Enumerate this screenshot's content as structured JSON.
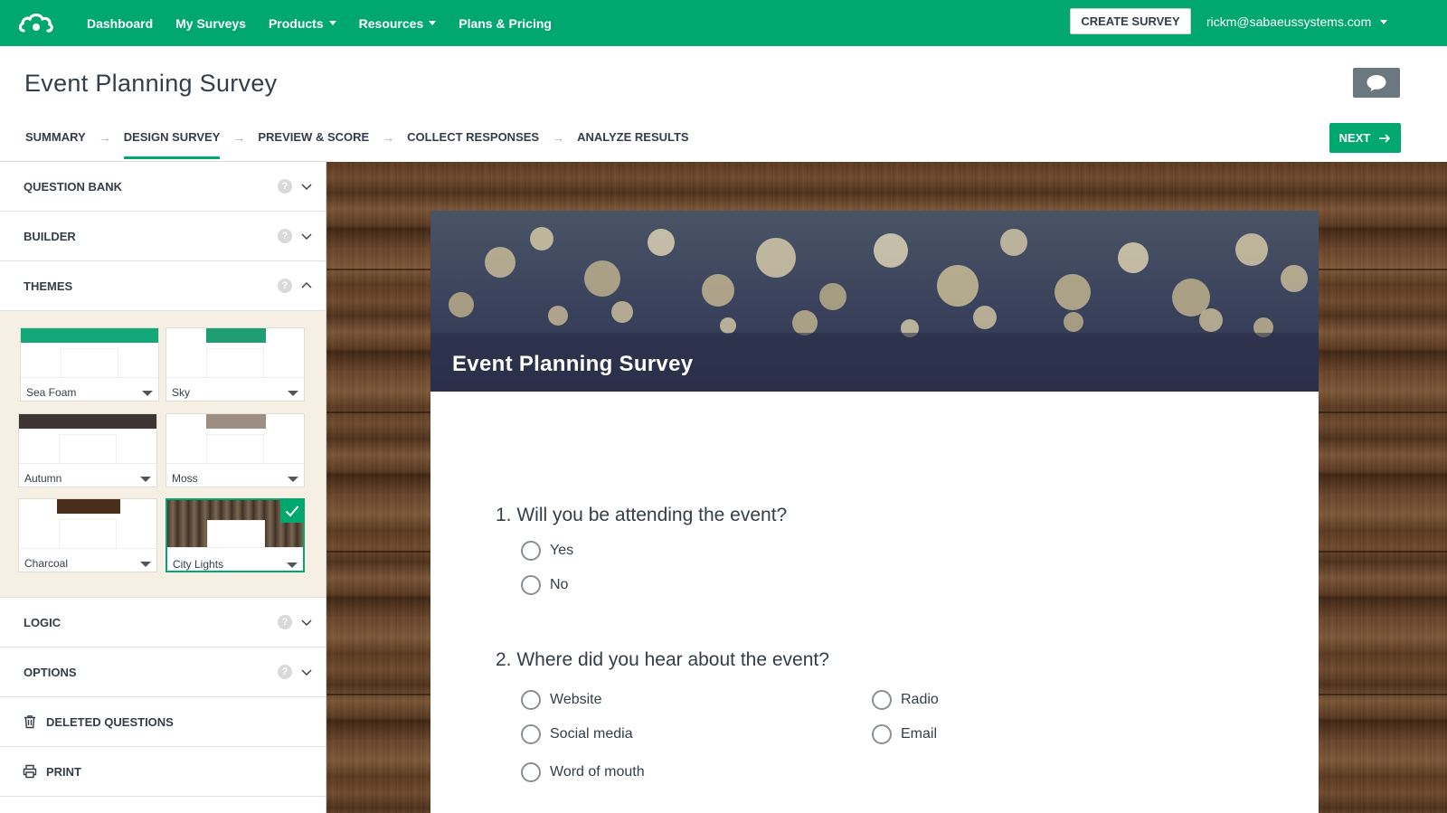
{
  "nav": {
    "items": [
      {
        "label": "Dashboard",
        "dropdown": false
      },
      {
        "label": "My Surveys",
        "dropdown": false
      },
      {
        "label": "Products",
        "dropdown": true
      },
      {
        "label": "Resources",
        "dropdown": true
      },
      {
        "label": "Plans & Pricing",
        "dropdown": false
      }
    ],
    "create_label": "CREATE SURVEY",
    "user_email": "rickm@sabaeussystems.com",
    "brand_color": "#00a870"
  },
  "header": {
    "title": "Event Planning Survey",
    "steps": [
      "SUMMARY",
      "DESIGN SURVEY",
      "PREVIEW & SCORE",
      "COLLECT RESPONSES",
      "ANALYZE RESULTS"
    ],
    "active_step": "DESIGN SURVEY",
    "next_label": "NEXT"
  },
  "sidebar": {
    "panels": {
      "question_bank": "QUESTION BANK",
      "builder": "BUILDER",
      "themes": "THEMES",
      "logic": "LOGIC",
      "options": "OPTIONS"
    },
    "help_glyph": "?",
    "themes": [
      {
        "name": "Sea Foam",
        "band_color": "#13a87a"
      },
      {
        "name": "Sky",
        "band_color": "#1f9e74"
      },
      {
        "name": "Autumn",
        "band_color": "#3e3433"
      },
      {
        "name": "Moss",
        "band_color": "#9c8e80"
      },
      {
        "name": "Charcoal",
        "band_color": "#4a2e1c"
      },
      {
        "name": "City Lights",
        "band_color": "#5a4a3a",
        "selected": true
      }
    ],
    "deleted_label": "DELETED QUESTIONS",
    "print_label": "PRINT"
  },
  "survey": {
    "title": "Event Planning Survey",
    "questions": [
      {
        "text": "1. Will you be attending the event?",
        "options": [
          "Yes",
          "No"
        ]
      },
      {
        "text": "2. Where did you hear about the event?",
        "options": [
          "Website",
          "Social media",
          "Word of mouth",
          "Radio",
          "Email"
        ]
      }
    ]
  }
}
